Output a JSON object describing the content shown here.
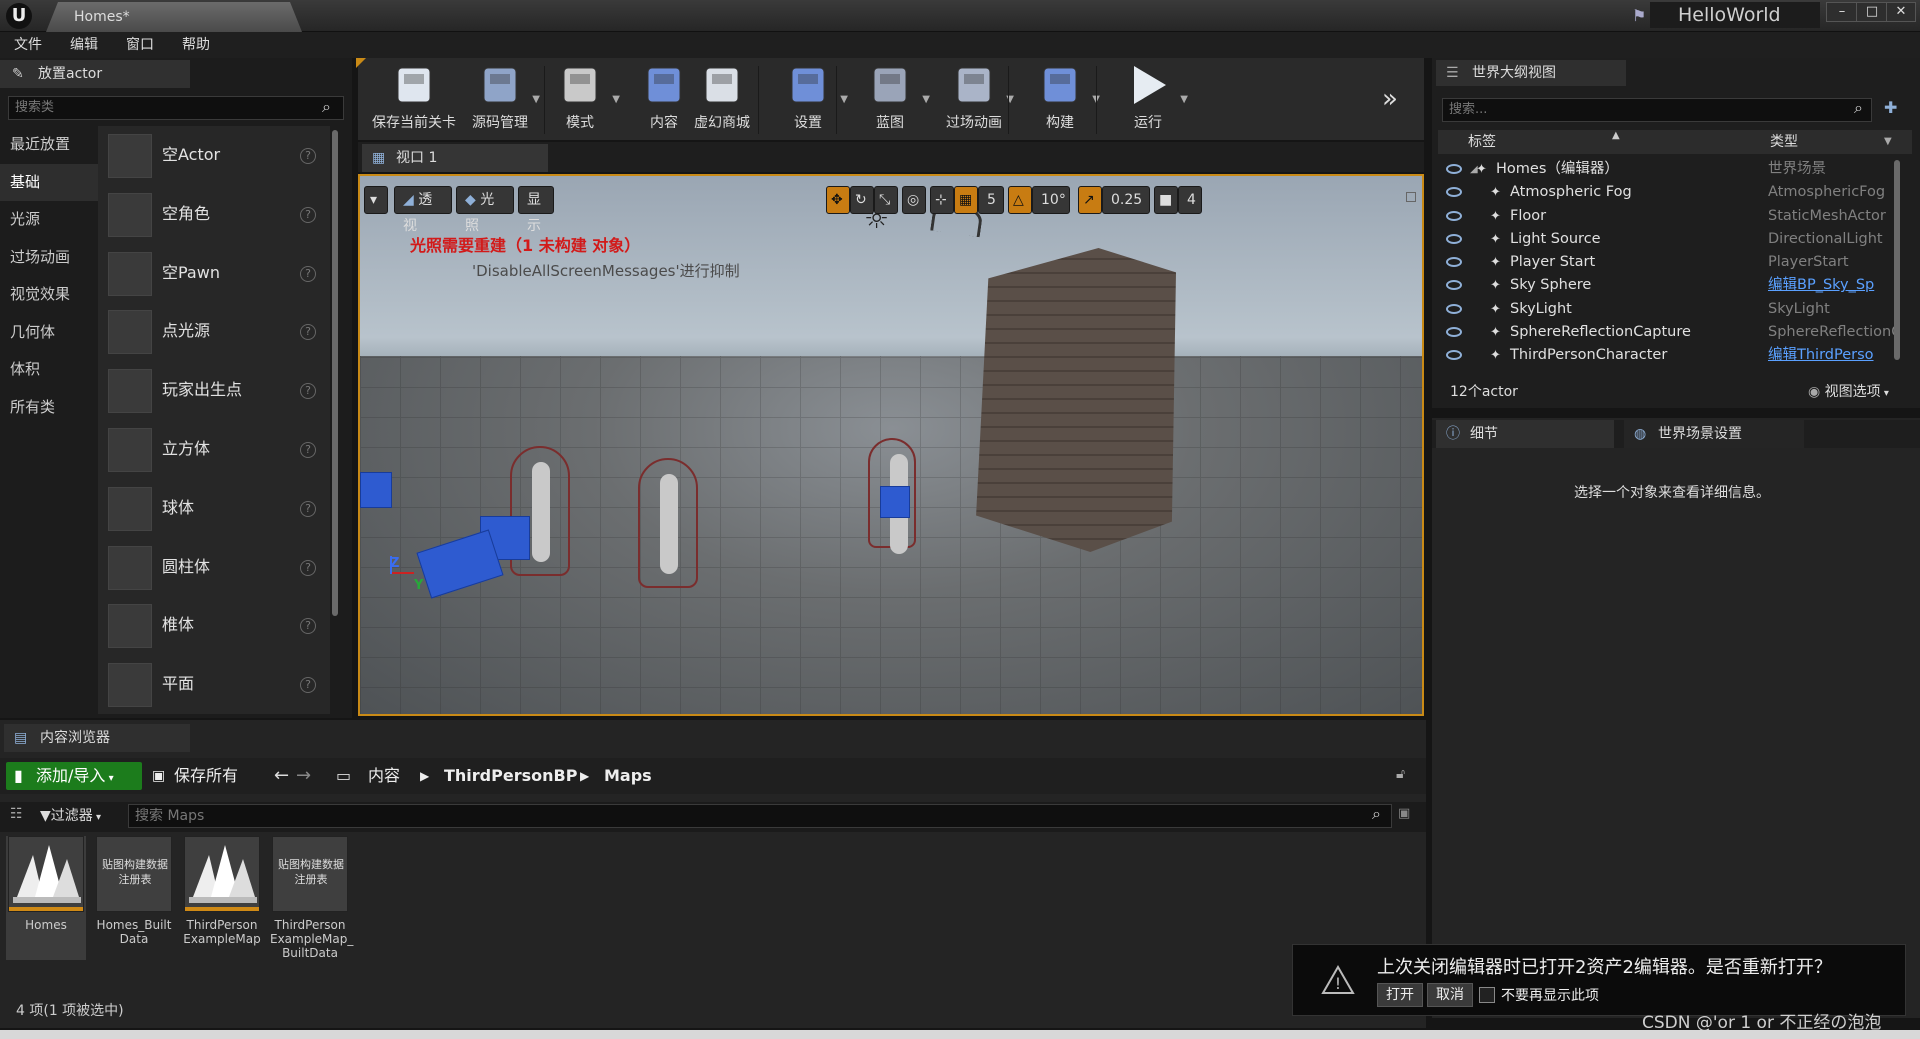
{
  "window": {
    "doc_tab": "Homes*",
    "project": "HelloWorld",
    "controls": [
      "–",
      "□",
      "✕"
    ]
  },
  "menu": [
    "文件",
    "编辑",
    "窗口",
    "帮助"
  ],
  "place_actors": {
    "tab": "放置actor",
    "search_placeholder": "搜索类",
    "categories": [
      "最近放置",
      "基础",
      "光源",
      "过场动画",
      "视觉效果",
      "几何体",
      "体积",
      "所有类"
    ],
    "active_category": "基础",
    "items": [
      {
        "name": "空Actor",
        "icon": "empty-actor-icon"
      },
      {
        "name": "空角色",
        "icon": "character-icon"
      },
      {
        "name": "空Pawn",
        "icon": "pawn-icon"
      },
      {
        "name": "点光源",
        "icon": "point-light-icon"
      },
      {
        "name": "玩家出生点",
        "icon": "player-start-icon"
      },
      {
        "name": "立方体",
        "icon": "cube-icon"
      },
      {
        "name": "球体",
        "icon": "sphere-icon"
      },
      {
        "name": "圆柱体",
        "icon": "cylinder-icon"
      },
      {
        "name": "椎体",
        "icon": "cone-icon"
      },
      {
        "name": "平面",
        "icon": "plane-icon"
      }
    ]
  },
  "toolbar": {
    "buttons": [
      {
        "label": "保存当前关卡",
        "icon": "save-icon",
        "dropdown": false
      },
      {
        "label": "源码管理",
        "icon": "source-control-icon",
        "dropdown": true
      },
      {
        "label": "模式",
        "icon": "modes-icon",
        "dropdown": true
      },
      {
        "label": "内容",
        "icon": "content-icon",
        "dropdown": false
      },
      {
        "label": "虚幻商城",
        "icon": "marketplace-icon",
        "dropdown": false
      },
      {
        "label": "设置",
        "icon": "settings-icon",
        "dropdown": true
      },
      {
        "label": "蓝图",
        "icon": "blueprint-icon",
        "dropdown": true
      },
      {
        "label": "过场动画",
        "icon": "cinematics-icon",
        "dropdown": true
      },
      {
        "label": "构建",
        "icon": "build-icon",
        "dropdown": true
      },
      {
        "label": "运行",
        "icon": "play-icon",
        "dropdown": true
      }
    ],
    "more": "»"
  },
  "viewport": {
    "tab": "视口 1",
    "menu_arrow": "▾",
    "perspective": "透视",
    "lit": "光照",
    "show": "显示",
    "grid_snap": "5",
    "rotation_snap": "10°",
    "scale_snap": "0.25",
    "camera_speed": "4",
    "warning": "光照需要重建（1 未构建 对象）",
    "suppress_hint": "'DisableAllScreenMessages'进行抑制",
    "axis_labels": [
      "Z",
      "Y"
    ]
  },
  "outliner": {
    "tab": "世界大纲视图",
    "search_placeholder": "搜索...",
    "col_label": "标签",
    "col_type": "类型",
    "rows": [
      {
        "label": "Homes（编辑器）",
        "type": "世界场景",
        "link": false,
        "indent": 0,
        "icon": "world-icon"
      },
      {
        "label": "Atmospheric Fog",
        "type": "AtmosphericFog",
        "link": false,
        "indent": 1,
        "icon": "fog-icon"
      },
      {
        "label": "Floor",
        "type": "StaticMeshActor",
        "link": false,
        "indent": 1,
        "icon": "mesh-icon"
      },
      {
        "label": "Light Source",
        "type": "DirectionalLight",
        "link": false,
        "indent": 1,
        "icon": "directional-light-icon"
      },
      {
        "label": "Player Start",
        "type": "PlayerStart",
        "link": false,
        "indent": 1,
        "icon": "player-start-icon"
      },
      {
        "label": "Sky Sphere",
        "type": "编辑BP_Sky_Sp",
        "link": true,
        "indent": 1,
        "icon": "sky-sphere-icon"
      },
      {
        "label": "SkyLight",
        "type": "SkyLight",
        "link": false,
        "indent": 1,
        "icon": "skylight-icon"
      },
      {
        "label": "SphereReflectionCapture",
        "type": "SphereReflectionC",
        "link": false,
        "indent": 1,
        "icon": "reflection-capture-icon"
      },
      {
        "label": "ThirdPersonCharacter",
        "type": "编辑ThirdPerso",
        "link": true,
        "indent": 1,
        "icon": "character-icon"
      }
    ],
    "count": "12个actor",
    "view_options": "视图选项"
  },
  "details": {
    "tab_details": "细节",
    "tab_world": "世界场景设置",
    "hint": "选择一个对象来查看详细信息。"
  },
  "content_browser": {
    "tab": "内容浏览器",
    "add_import": "添加/导入",
    "save_all": "保存所有",
    "crumbs": [
      "内容",
      "ThirdPersonBP",
      "Maps"
    ],
    "filter": "过滤器",
    "search_placeholder": "搜索 Maps",
    "assets": [
      {
        "name": "Homes",
        "kind": "map",
        "selected": true
      },
      {
        "name": "Homes_Built Data",
        "kind": "registry",
        "thumb_text": "贴图构建数据注册表",
        "selected": false
      },
      {
        "name": "ThirdPerson ExampleMap",
        "kind": "map",
        "selected": false
      },
      {
        "name": "ThirdPerson ExampleMap_ BuiltData",
        "kind": "registry",
        "thumb_text": "贴图构建数据注册表",
        "selected": false
      }
    ],
    "status": "4 项(1 项被选中)"
  },
  "notification": {
    "message": "上次关闭编辑器时已打开2资产2编辑器。是否重新打开？",
    "open": "打开",
    "cancel": "取消",
    "dont_show": "不要再显示此项"
  },
  "watermark": "CSDN @'or 1 or 不正经の泡泡",
  "colors": {
    "accent": "#c98a16",
    "add_button": "#1c7c1c",
    "link": "#5aa0ff",
    "warning": "#d21a1a"
  }
}
